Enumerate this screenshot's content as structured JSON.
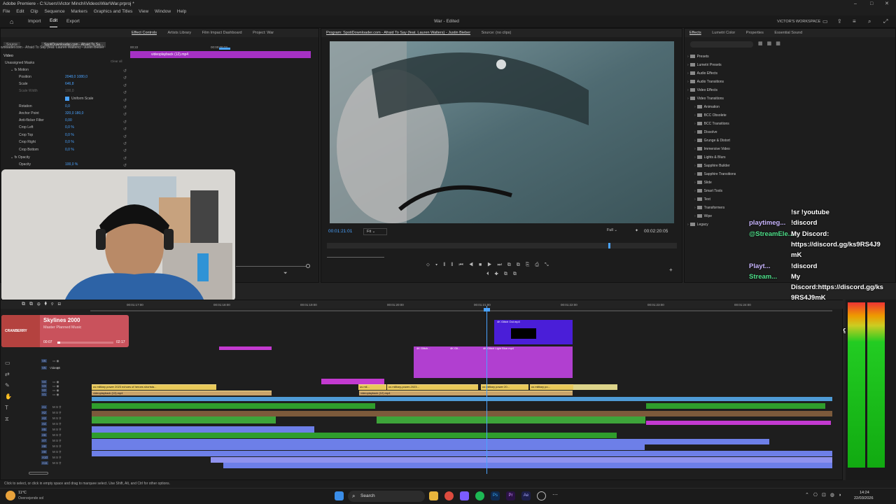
{
  "window": {
    "title": "Adobe Premiere - C:\\Users\\Victor Minchi\\Videos\\War\\War.prproj *",
    "controls": [
      "–",
      "□",
      "✕"
    ]
  },
  "menu": [
    "File",
    "Edit",
    "Clip",
    "Sequence",
    "Markers",
    "Graphics and Titles",
    "View",
    "Window",
    "Help"
  ],
  "workspace": {
    "tabs": [
      "Import",
      "Edit",
      "Export"
    ],
    "active": "Edit",
    "center_title": "War - Edited",
    "user": "VICTOR'S WORKSPACE"
  },
  "left_panel": {
    "tabs": [
      "Effect Controls",
      "Artists Library",
      "Film Impact Dashboard",
      "Project: War"
    ],
    "subtabs": [
      "Source: *",
      "SpotiDownloader.com - Afraid To Say (feat. Lauren Walters) - Justin Bieber",
      "Text",
      "Effect Controls"
    ],
    "sub_source": "Source",
    "sub_seq": "SpotiDownloader.com - Afraid To Sa...",
    "master": "wnloader.com - Afraid To Say (feat. Lauren Walters) - Justin Bieber",
    "timecode_left": "00:22",
    "timecode_right": "00:00:00:23",
    "clip_label": "videoplayback (12).mp4",
    "section_video": "Video",
    "clear_all": "Clear all",
    "rows": [
      {
        "label": "Unassigned Masks",
        "value": ""
      },
      {
        "label": "Motion",
        "value": ""
      },
      {
        "label": "Position",
        "value": "2048,0   1080,0"
      },
      {
        "label": "Scale",
        "value": "646,8"
      },
      {
        "label": "Scale Width",
        "value": "100,0"
      },
      {
        "label": "Uniform Scale",
        "value": ""
      },
      {
        "label": "Rotation",
        "value": "0,0"
      },
      {
        "label": "Anchor Point",
        "value": "320,0   180,0"
      },
      {
        "label": "Anti-flicker Filter",
        "value": "0,00"
      },
      {
        "label": "Crop Left",
        "value": "0,0 %"
      },
      {
        "label": "Crop Top",
        "value": "0,0 %"
      },
      {
        "label": "Crop Right",
        "value": "0,0 %"
      },
      {
        "label": "Crop Bottom",
        "value": "0,0 %"
      },
      {
        "label": "Opacity",
        "value": ""
      },
      {
        "label": "Opacity",
        "value": "100,0 %"
      }
    ]
  },
  "program": {
    "tabs": [
      "Program: SpotiDownloader.com - Afraid To Say (feat. Lauren Walters) - Justin Bieber",
      "Source: (no clips)"
    ],
    "timecode": "00:01:21:01",
    "fit": "Fit",
    "quality": "Full",
    "duration": "00:02:20:05"
  },
  "effects_panel": {
    "tabs": [
      "Effects",
      "Lumetri Color",
      "Properties",
      "Essential Sound"
    ],
    "items": [
      {
        "label": "Presets",
        "indent": 0
      },
      {
        "label": "Lumetri Presets",
        "indent": 0
      },
      {
        "label": "Audio Effects",
        "indent": 0
      },
      {
        "label": "Audio Transitions",
        "indent": 0
      },
      {
        "label": "Video Effects",
        "indent": 0
      },
      {
        "label": "Video Transitions",
        "indent": 0
      },
      {
        "label": "Animation",
        "indent": 1
      },
      {
        "label": "BCC Obsolete",
        "indent": 1
      },
      {
        "label": "BCC Transitions",
        "indent": 1
      },
      {
        "label": "Dissolve",
        "indent": 1
      },
      {
        "label": "Grunge & Distort",
        "indent": 1
      },
      {
        "label": "Immersive Video",
        "indent": 1
      },
      {
        "label": "Lights & Blurs",
        "indent": 1
      },
      {
        "label": "Sapphire Builder",
        "indent": 1
      },
      {
        "label": "Sapphire Transitions",
        "indent": 1
      },
      {
        "label": "Slide",
        "indent": 1
      },
      {
        "label": "Smart Tools",
        "indent": 1
      },
      {
        "label": "Text",
        "indent": 1
      },
      {
        "label": "Transformers",
        "indent": 1
      },
      {
        "label": "Wipe",
        "indent": 1
      },
      {
        "label": "Legacy",
        "indent": 0
      }
    ]
  },
  "chat": [
    {
      "user": "",
      "text": "!sr !youtube"
    },
    {
      "user": "playtimeg...",
      "text": "!discord"
    },
    {
      "user": "@StreamEle...",
      "text": "My Discord:"
    },
    {
      "user": "",
      "text": "https://discord.gg/ks9RS4J9"
    },
    {
      "user": "",
      "text": "mK"
    },
    {
      "user": "Playt...",
      "text": "!discord"
    },
    {
      "user": "Stream...",
      "text": "My"
    },
    {
      "user": "",
      "text": "Discord:https://discord.gg/ks"
    },
    {
      "user": "",
      "text": "9RS4J9mK"
    },
    {
      "user": "",
      "text": "!discord"
    },
    {
      "user": "@StreamE...",
      "text": "My Discord:"
    },
    {
      "user": "",
      "text": "https://discord.gg/ks9RS4J9"
    },
    {
      "user": "",
      "text": "mK"
    }
  ],
  "now_playing": {
    "title": "Skylines 2000",
    "subtitle": "Master Planned Music",
    "brand": "CRANBERRY",
    "time_current": "00:07",
    "time_total": "02:17",
    "progress": 0.05
  },
  "timeline": {
    "ruler": [
      "00:01:17:00",
      "00:01:18:00",
      "00:01:19:00",
      "00:01:20:00",
      "00:01:21:00",
      "00:01:22:00",
      "00:01:23:00",
      "00:01:24:00"
    ],
    "tracks": [
      "V6",
      "V5",
      "V4",
      "V3",
      "V2",
      "V1",
      "A1",
      "A2",
      "A3",
      "A4",
      "A5",
      "A6",
      "A7",
      "A8",
      "A9",
      "A10",
      "A11"
    ],
    "video_track_label": "Video 5",
    "clips": {
      "glitch_out": "4K Glitch Out.mp4",
      "glitch_light": "4K Glitch Light Blue.mp4",
      "glitch_a": "4K Glitch...",
      "glitch_b": "4K Gli...",
      "yellow_1": "us military power 2023 echoes of heroes shortsta...",
      "yellow_2": "us mil...",
      "yellow_3": "us military-power-2023...",
      "yellow_4": "us military power 20...",
      "yellow_5": "us military po...",
      "yellow_6": "videoplayback (13).mp4",
      "yellow_7": "videoplayback (12).mp4"
    }
  },
  "status_bar": "Click to select, or click in empty space and drag to marquee select. Use Shift, Alt, and Ctrl for other options.",
  "taskbar": {
    "weather_temp": "11°C",
    "weather_desc": "Overvejende sol",
    "search": "Search",
    "time": "14:24",
    "date": "22/03/2026"
  },
  "colors": {
    "accent_blue": "#4aa3ff",
    "clip_magenta": "#c33ad0",
    "clip_yellow": "#e8c95a",
    "audio_green": "#2f9d2c",
    "audio_blue": "#6d7fe8"
  }
}
